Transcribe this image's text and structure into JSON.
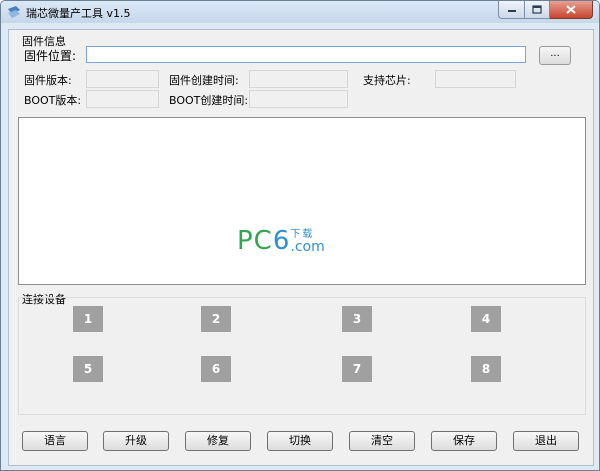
{
  "window": {
    "title": "瑞芯微量产工具 v1.5"
  },
  "firmware_info": {
    "group_label": "固件信息",
    "location_label": "固件位置:",
    "location_value": "",
    "browse_label": "...",
    "version_label": "固件版本:",
    "created_label": "固件创建时间:",
    "chip_label": "支持芯片:",
    "boot_version_label": "BOOT版本:",
    "boot_created_label": "BOOT创建时间:"
  },
  "watermark": {
    "pc": "PC",
    "six": "6",
    "cn": "下载",
    "com": ".com"
  },
  "devices": {
    "group_label": "连接设备",
    "slots": [
      "1",
      "2",
      "3",
      "4",
      "5",
      "6",
      "7",
      "8"
    ]
  },
  "buttons": [
    "语言",
    "升级",
    "修复",
    "切换",
    "清空",
    "保存",
    "退出"
  ]
}
